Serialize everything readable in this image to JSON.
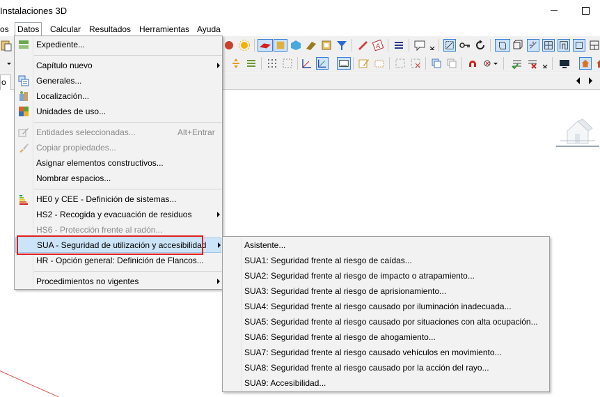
{
  "window": {
    "title": "Instalaciones 3D"
  },
  "menubar": {
    "items": [
      {
        "label": "os"
      },
      {
        "label": "Datos"
      },
      {
        "label": "Calcular"
      },
      {
        "label": "Resultados"
      },
      {
        "label": "Herramientas"
      },
      {
        "label": "Ayuda"
      }
    ]
  },
  "tabs": {
    "active_label": "o"
  },
  "datos_menu": {
    "items": [
      {
        "label": "Expediente...",
        "icon": "expediente-icon"
      },
      {
        "label": "Capítulo nuevo",
        "submenu": true
      },
      {
        "label": "Generales...",
        "icon": "generales-icon"
      },
      {
        "label": "Localización...",
        "icon": "localizacion-icon"
      },
      {
        "label": "Unidades de uso...",
        "icon": "unidades-icon"
      },
      {
        "label": "Entidades seleccionadas...",
        "accelerator": "Alt+Entrar",
        "disabled": true,
        "icon": "entidades-icon"
      },
      {
        "label": "Copiar propiedades...",
        "disabled": true,
        "icon": "brush-icon"
      },
      {
        "label": "Asignar elementos constructivos..."
      },
      {
        "label": "Nombrar espacios..."
      },
      {
        "label": "HE0 y CEE - Definición de sistemas...",
        "icon": "energy-label-icon"
      },
      {
        "label": "HS2 - Recogida y evacuación de residuos",
        "submenu": true
      },
      {
        "label": "HS6 - Protección frente al radón...",
        "disabled": true
      },
      {
        "label": "SUA - Seguridad de utilización y accesibilidad",
        "submenu": true,
        "highlighted": true
      },
      {
        "label": "HR - Opción general: Definición de Flancos..."
      },
      {
        "label": "Procedimientos no vigentes",
        "submenu": true
      }
    ]
  },
  "sua_submenu": {
    "items": [
      {
        "label": "Asistente..."
      },
      {
        "label": "SUA1: Seguridad frente al riesgo de caídas..."
      },
      {
        "label": "SUA2: Seguridad frente al riesgo de impacto o atrapamiento..."
      },
      {
        "label": "SUA3: Seguridad frente al riesgo de aprisionamiento..."
      },
      {
        "label": "SUA4: Seguridad frente al riesgo causado por iluminación inadecuada..."
      },
      {
        "label": "SUA5: Seguridad frente al riesgo causado por situaciones con alta ocupación..."
      },
      {
        "label": "SUA6: Seguridad frente al riesgo de ahogamiento..."
      },
      {
        "label": "SUA7: Seguridad frente al riesgo causado vehículos en movimiento..."
      },
      {
        "label": "SUA8: Seguridad frente al riesgo causado por la acción del rayo..."
      },
      {
        "label": "SUA9: Accesibilidad..."
      }
    ]
  },
  "colors": {
    "highlight": "#cce4f7",
    "callout": "#e02020",
    "menu_bg": "#f2f2f2"
  }
}
